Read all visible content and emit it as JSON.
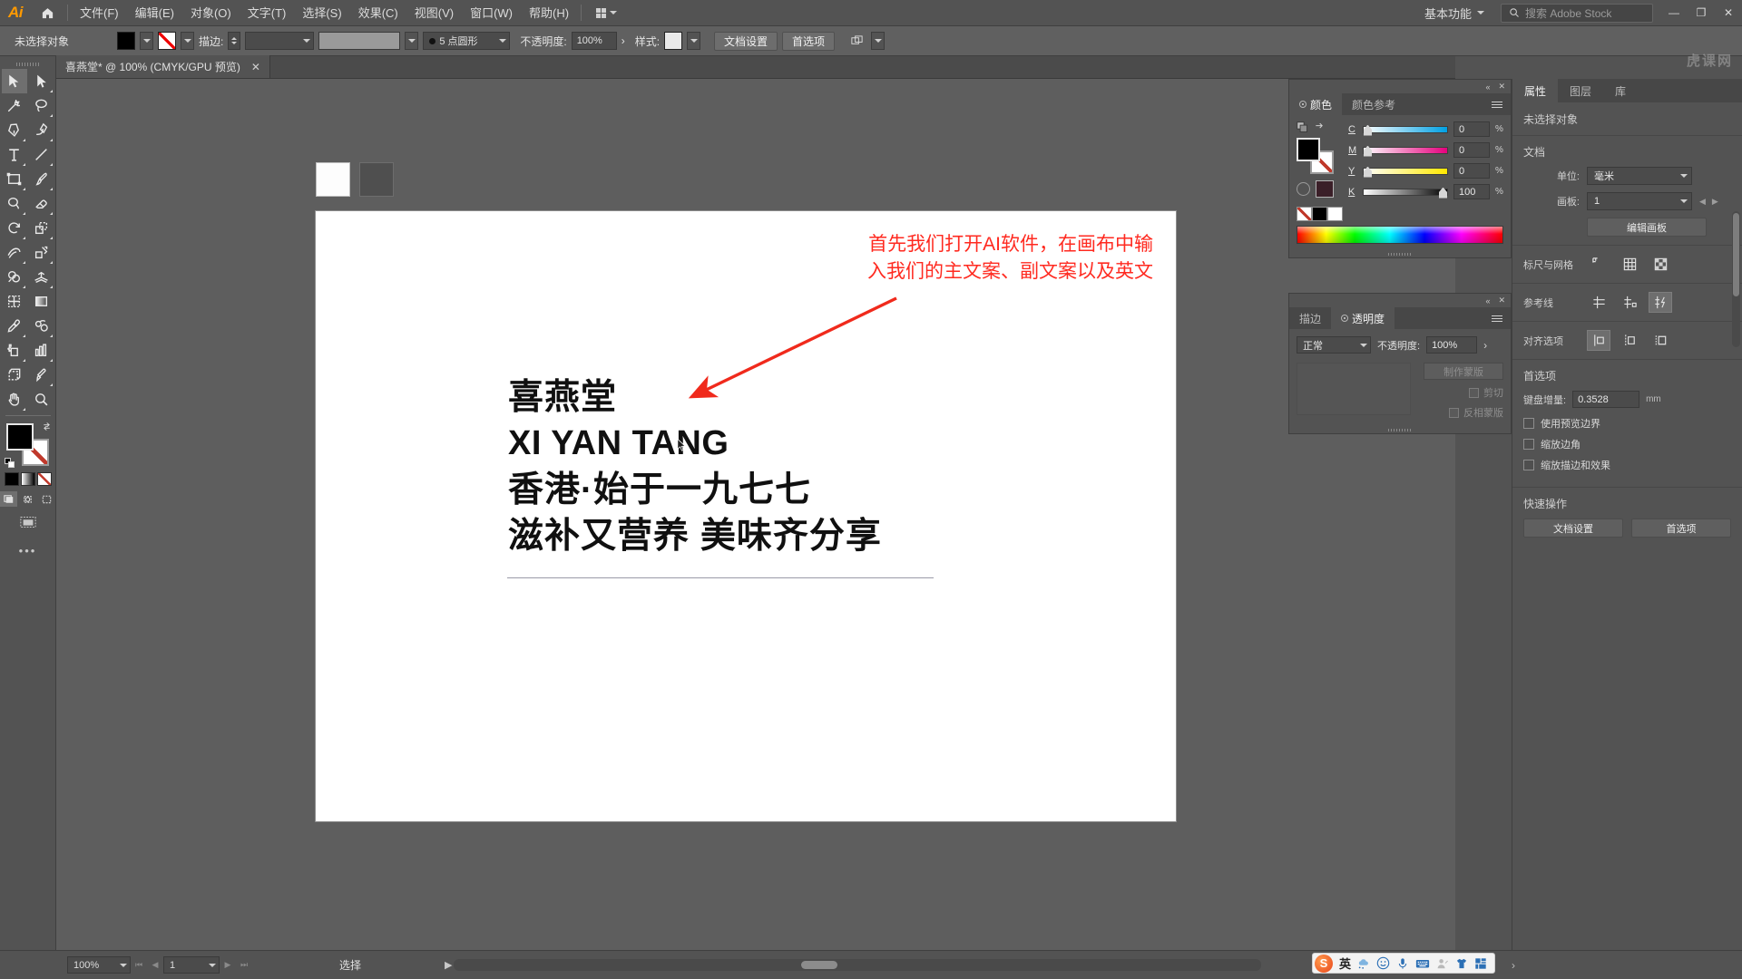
{
  "app": {
    "name": "Adobe Illustrator",
    "logo_text": "Ai",
    "watermark": "虎课网"
  },
  "menubar": {
    "home_icon": "home-icon",
    "items": [
      {
        "label": "文件(F)"
      },
      {
        "label": "编辑(E)"
      },
      {
        "label": "对象(O)"
      },
      {
        "label": "文字(T)"
      },
      {
        "label": "选择(S)"
      },
      {
        "label": "效果(C)"
      },
      {
        "label": "视图(V)"
      },
      {
        "label": "窗口(W)"
      },
      {
        "label": "帮助(H)"
      }
    ],
    "arrange_documents_icon": "grid-icon",
    "workspace": "基本功能",
    "search_placeholder": "搜索 Adobe Stock",
    "window_controls": {
      "minimize": "—",
      "restore": "❐",
      "close": "✕"
    }
  },
  "optionsbar": {
    "selection_status": "未选择对象",
    "fill_label": "fill-swatch",
    "stroke_swatch_label": "stroke-swatch-none",
    "stroke_label": "描边:",
    "stroke_weight": "",
    "stroke_profile": "",
    "brush_definition": "",
    "variable_width_profile": "5 点圆形",
    "opacity_label": "不透明度:",
    "opacity_value": "100%",
    "style_label": "样式:",
    "doc_setup_button": "文档设置",
    "preferences_button": "首选项",
    "arrange_label": "排列"
  },
  "toolbar": {
    "tools": [
      {
        "name": "selection-tool",
        "active": true
      },
      {
        "name": "direct-selection-tool",
        "active": false
      },
      {
        "name": "magic-wand-tool",
        "active": false
      },
      {
        "name": "lasso-tool",
        "active": false
      },
      {
        "name": "pen-tool",
        "active": false
      },
      {
        "name": "curvature-tool",
        "active": false
      },
      {
        "name": "type-tool",
        "active": false
      },
      {
        "name": "line-segment-tool",
        "active": false
      },
      {
        "name": "rectangle-tool",
        "active": false
      },
      {
        "name": "paintbrush-tool",
        "active": false
      },
      {
        "name": "shaper-tool",
        "active": false
      },
      {
        "name": "eraser-tool",
        "active": false
      },
      {
        "name": "rotate-tool",
        "active": false
      },
      {
        "name": "scale-tool",
        "active": false
      },
      {
        "name": "width-tool",
        "active": false
      },
      {
        "name": "free-transform-tool",
        "active": false
      },
      {
        "name": "shape-builder-tool",
        "active": false
      },
      {
        "name": "perspective-grid-tool",
        "active": false
      },
      {
        "name": "mesh-tool",
        "active": false
      },
      {
        "name": "gradient-tool",
        "active": false
      },
      {
        "name": "eyedropper-tool",
        "active": false
      },
      {
        "name": "blend-tool",
        "active": false
      },
      {
        "name": "symbol-sprayer-tool",
        "active": false
      },
      {
        "name": "column-graph-tool",
        "active": false
      },
      {
        "name": "artboard-tool",
        "active": false
      },
      {
        "name": "slice-tool",
        "active": false
      },
      {
        "name": "hand-tool",
        "active": false
      },
      {
        "name": "zoom-tool",
        "active": false
      }
    ],
    "fill_color": "#000000",
    "stroke_color": "none",
    "color_modes": [
      "color-mode-solid",
      "color-mode-gradient",
      "color-mode-none"
    ],
    "drawing_modes": [
      "draw-normal",
      "draw-behind",
      "draw-inside"
    ],
    "screen_mode": "change-screen-mode",
    "more_tools": "•••"
  },
  "document": {
    "tab_title": "喜燕堂* @ 100% (CMYK/GPU 预览)",
    "close_icon": "✕"
  },
  "canvas": {
    "annotation": {
      "line1": "首先我们打开AI软件，在画布中输",
      "line2": "入我们的主文案、副文案以及英文",
      "color": "#ff2a20"
    },
    "artwork_text": [
      {
        "text": "喜燕堂"
      },
      {
        "text": "XI YAN TANG"
      },
      {
        "text": "香港·始于一九七七"
      },
      {
        "text": "滋补又营养 美味齐分享"
      }
    ],
    "swatches": [
      {
        "name": "white-swatch",
        "color": "#fdfdfd"
      },
      {
        "name": "dark-swatch",
        "color": "#4f4f4f"
      }
    ]
  },
  "color_panel": {
    "tabs": [
      {
        "label": "颜色",
        "active": true
      },
      {
        "label": "颜色参考",
        "active": false
      }
    ],
    "sliders": [
      {
        "label": "C",
        "value": "0",
        "unit": "%"
      },
      {
        "label": "M",
        "value": "0",
        "unit": "%"
      },
      {
        "label": "Y",
        "value": "0",
        "unit": "%"
      },
      {
        "label": "K",
        "value": "100",
        "unit": "%"
      }
    ],
    "menu_icon": "panel-menu-icon",
    "collapse_icon": "«",
    "close_icon": "✕"
  },
  "transparency_panel": {
    "tabs": [
      {
        "label": "描边",
        "active": false
      },
      {
        "label": "透明度",
        "active": true
      }
    ],
    "blend_mode": "正常",
    "opacity_label": "不透明度:",
    "opacity_value": "100%",
    "make_mask_button": "制作蒙版",
    "clip_checkbox": "剪切",
    "invert_mask_checkbox": "反相蒙版",
    "collapse_icon": "«",
    "close_icon": "✕"
  },
  "properties_panel": {
    "tabs": [
      {
        "label": "属性",
        "active": true
      },
      {
        "label": "图层",
        "active": false
      },
      {
        "label": "库",
        "active": false
      }
    ],
    "no_selection": "未选择对象",
    "document_section": {
      "title": "文档",
      "unit_label": "单位:",
      "unit_value": "毫米",
      "artboard_label": "画板:",
      "artboard_value": "1",
      "edit_artboards_button": "编辑画板"
    },
    "rulers_section": {
      "title": "标尺与网格",
      "icons": [
        "show-rulers-icon",
        "show-grid-icon",
        "show-transparency-grid-icon"
      ]
    },
    "guides_section": {
      "title": "参考线",
      "icons": [
        "show-guides-icon",
        "lock-guides-icon",
        "smart-guides-icon"
      ]
    },
    "align_section": {
      "title": "对齐选项",
      "icons": [
        "align-to-selection-icon",
        "align-to-key-object-icon",
        "align-to-artboard-icon"
      ]
    },
    "preferences_section": {
      "title": "首选项",
      "keyboard_increment_label": "键盘增量:",
      "keyboard_increment_value": "0.3528",
      "keyboard_increment_unit": "mm",
      "checkboxes": [
        {
          "label": "使用预览边界",
          "checked": false
        },
        {
          "label": "缩放边角",
          "checked": false
        },
        {
          "label": "缩放描边和效果",
          "checked": false
        }
      ]
    },
    "quick_actions": {
      "title": "快速操作",
      "buttons": [
        "文档设置",
        "首选项"
      ]
    }
  },
  "statusbar": {
    "zoom_level": "100%",
    "artboard_number": "1",
    "current_tool": "选择",
    "first_icon": "⏮",
    "prev_icon": "◀",
    "next_icon": "▶",
    "last_icon": "⏭",
    "play_icon": "▶",
    "back_icon": "‹",
    "forward_icon": "›"
  },
  "ime": {
    "logo": "S",
    "mode": "英",
    "items": [
      "sogou-logo-icon",
      "input-mode-icon",
      "weather-icon",
      "emoji-icon",
      "microphone-icon",
      "keyboard-icon",
      "handwriting-icon",
      "skin-icon",
      "toolbox-icon"
    ]
  }
}
